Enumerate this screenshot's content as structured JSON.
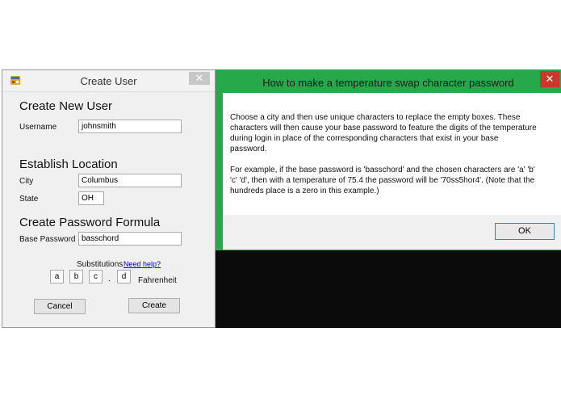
{
  "create_user": {
    "title": "Create User",
    "close_label": "✕",
    "new_user_heading": "Create New User",
    "username_label": "Username",
    "username_value": "johnsmith",
    "location_heading": "Establish Location",
    "city_label": "City",
    "city_value": "Columbus",
    "state_label": "State",
    "state_value": "OH",
    "password_heading": "Create Password Formula",
    "base_password_label": "Base Password",
    "base_password_value": "basschord",
    "substitutions_label": "Substitutions",
    "help_link": "Need help?",
    "chars": [
      "a",
      "b",
      "c",
      "d"
    ],
    "decimal_point": ".",
    "unit_label": "Fahrenheit",
    "cancel_label": "Cancel",
    "create_label": "Create"
  },
  "dialog": {
    "title": "How to make a temperature swap character password",
    "close_label": "✕",
    "paragraph1": "Choose a city and then use unique characters to replace the empty boxes. These characters will then cause your base password to feature the digits of the temperature during login in place of the corresponding characters that exist in your base password.",
    "paragraph2": "For example, if the base password is 'basschord' and the chosen characters are 'a' 'b' 'c' 'd', then with a temperature of 75.4 the password will be '70ss5hor4'. (Note that the hundreds place is a zero in this example.)",
    "ok_label": "OK"
  },
  "colors": {
    "dialog_frame": "#27a84a",
    "close_red": "#c8382b",
    "link_blue": "#0000cc"
  }
}
